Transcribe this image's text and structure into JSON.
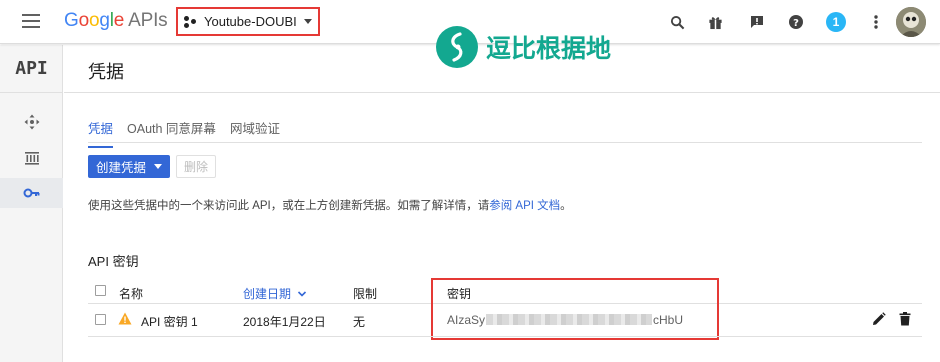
{
  "topbar": {
    "brand_google": [
      "G",
      "o",
      "o",
      "g",
      "l",
      "e"
    ],
    "brand_apis": "APIs",
    "project_name": "Youtube-DOUBI",
    "notification_count": "1"
  },
  "watermark": {
    "text": "逗比根据地"
  },
  "leftnav": {
    "logo": "API"
  },
  "header": {
    "title": "凭据"
  },
  "tabs": [
    {
      "label": "凭据",
      "active": true
    },
    {
      "label": "OAuth 同意屏幕",
      "active": false
    },
    {
      "label": "网域验证",
      "active": false
    }
  ],
  "toolbar": {
    "create_label": "创建凭据",
    "delete_label": "删除"
  },
  "description": {
    "text": "使用这些凭据中的一个来访问此 API，或在上方创建新凭据。如需了解详情，请",
    "link": "参阅 API 文档",
    "suffix": "。"
  },
  "api_keys": {
    "section_title": "API 密钥",
    "columns": {
      "name": "名称",
      "created": "创建日期",
      "restriction": "限制",
      "key": "密钥"
    },
    "rows": [
      {
        "name": "API 密钥 1",
        "created": "2018年1月22日",
        "restriction": "无",
        "key_prefix": "AIzaSy",
        "key_suffix": "cHbU"
      }
    ]
  },
  "colors": {
    "accent": "#3367d6",
    "highlight": "#e53935",
    "watermark": "#13a890",
    "warning": "#f9a825"
  }
}
